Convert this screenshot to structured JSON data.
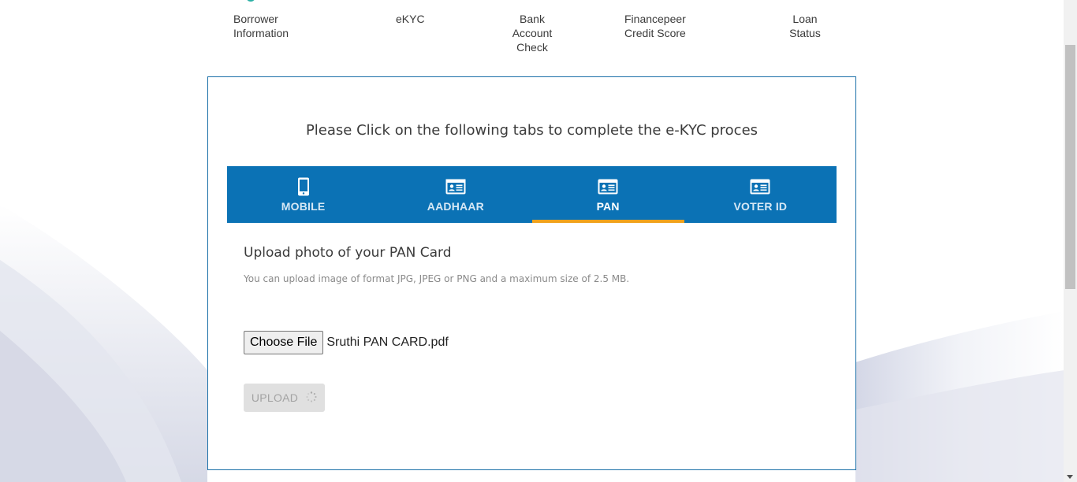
{
  "colors": {
    "tab_bar": "#0b72b5",
    "tab_active_indicator": "#f0a21c",
    "card_border": "#1a6fa8",
    "step_completed": "#2bb0a5"
  },
  "stepper": {
    "steps": [
      {
        "label": "Borrower\nInformation"
      },
      {
        "label": "eKYC"
      },
      {
        "label": "Bank\nAccount\nCheck"
      },
      {
        "label": "Financepeer\nCredit Score"
      },
      {
        "label": "Loan\nStatus"
      }
    ]
  },
  "card": {
    "title": "Please Click on the following tabs to complete the e-KYC proces",
    "tabs": [
      {
        "label": "MOBILE",
        "icon": "mobile-phone-icon"
      },
      {
        "label": "AADHAAR",
        "icon": "id-card-icon"
      },
      {
        "label": "PAN",
        "icon": "id-card-icon",
        "active": true
      },
      {
        "label": "VOTER ID",
        "icon": "id-card-icon"
      }
    ],
    "upload": {
      "title": "Upload photo of your PAN Card",
      "hint": "You can upload image of format JPG, JPEG or PNG and a maximum size of 2.5 MB.",
      "choose_file_label": "Choose File",
      "file_name": "Sruthi PAN  CARD.pdf",
      "upload_label": "UPLOAD",
      "spinner_icon": "loading-spinner-icon"
    }
  }
}
